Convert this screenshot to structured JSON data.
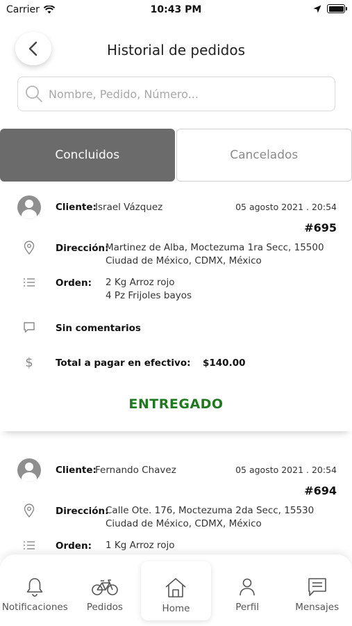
{
  "status_bar": {
    "carrier": "Carrier",
    "time": "10:43 PM"
  },
  "header": {
    "title": "Historial de pedidos"
  },
  "search": {
    "placeholder": "Nombre, Pedido, Número..."
  },
  "tabs": [
    {
      "label": "Concluidos",
      "active": true
    },
    {
      "label": "Cancelados",
      "active": false
    }
  ],
  "orders": [
    {
      "client_label": "Cliente:",
      "client": "Israel Vázquez",
      "date": "05 agosto 2021 . 20:54",
      "number": "#695",
      "address_label": "Dirección:",
      "address_line1": "Martinez de Alba, Moctezuma 1ra Secc, 15500",
      "address_line2": "Ciudad de México, CDMX, México",
      "order_label": "Orden:",
      "items": [
        "2 Kg Arroz rojo",
        "4 Pz Frijoles bayos"
      ],
      "comments": "Sin comentarios",
      "total_label": "Total a pagar en efectivo:",
      "total": "$140.00",
      "status": "ENTREGADO"
    },
    {
      "client_label": "Cliente:",
      "client": "Fernando Chavez",
      "date": "05 agosto 2021 . 20:54",
      "number": "#694",
      "address_label": "Dirección:",
      "address_line1": "Calle Ote. 176, Moctezuma 2da Secc, 15530",
      "address_line2": "Ciudad de México, CDMX, México",
      "order_label": "Orden:",
      "items": [
        "1 Kg Arroz rojo"
      ]
    }
  ],
  "bottom_nav": [
    {
      "label": "Notificaciones",
      "icon": "bell-icon"
    },
    {
      "label": "Pedidos",
      "icon": "bicycle-icon"
    },
    {
      "label": "Home",
      "icon": "home-icon",
      "active": true
    },
    {
      "label": "Perfil",
      "icon": "person-icon"
    },
    {
      "label": "Mensajes",
      "icon": "message-icon"
    }
  ],
  "colors": {
    "tab_active_bg": "#6b6b6b",
    "status_delivered": "#1e7a1e",
    "avatar": "#8f8f8f"
  }
}
